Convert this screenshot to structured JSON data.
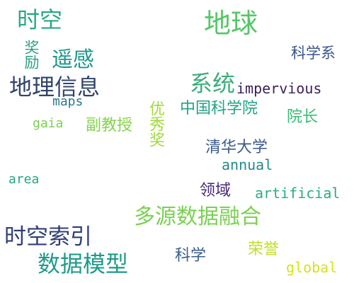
{
  "words": [
    {
      "text": "时空",
      "color": "#2aa884"
    },
    {
      "text": "地球",
      "color": "#55c667"
    },
    {
      "text": "科学系",
      "color": "#39568c"
    },
    {
      "text": "奖励",
      "color": "#2d9f85"
    },
    {
      "text": "遥感",
      "color": "#1f978b"
    },
    {
      "text": "地理信息",
      "color": "#31446b"
    },
    {
      "text": "系统",
      "color": "#3aae7b"
    },
    {
      "text": "impervious",
      "color": "#3b1f5c"
    },
    {
      "text": "maps",
      "color": "#2a788e"
    },
    {
      "text": "中国科学院",
      "color": "#20a386"
    },
    {
      "text": "院长",
      "color": "#3bbb75"
    },
    {
      "text": "gaia",
      "color": "#7ad151"
    },
    {
      "text": "副教授",
      "color": "#84d44b"
    },
    {
      "text": "优秀奖",
      "color": "#a0da39"
    },
    {
      "text": "清华大学",
      "color": "#3b5a8c"
    },
    {
      "text": "annual",
      "color": "#238a8d"
    },
    {
      "text": "area",
      "color": "#22a785"
    },
    {
      "text": "领域",
      "color": "#482878"
    },
    {
      "text": "artificial",
      "color": "#28ae80"
    },
    {
      "text": "多源数据融合",
      "color": "#7ad151"
    },
    {
      "text": "时空索引",
      "color": "#2f3f75"
    },
    {
      "text": "荣誉",
      "color": "#c2df23"
    },
    {
      "text": "数据模型",
      "color": "#1f9a8a"
    },
    {
      "text": "科学",
      "color": "#3a5e8c"
    },
    {
      "text": "global",
      "color": "#d8e219"
    }
  ]
}
